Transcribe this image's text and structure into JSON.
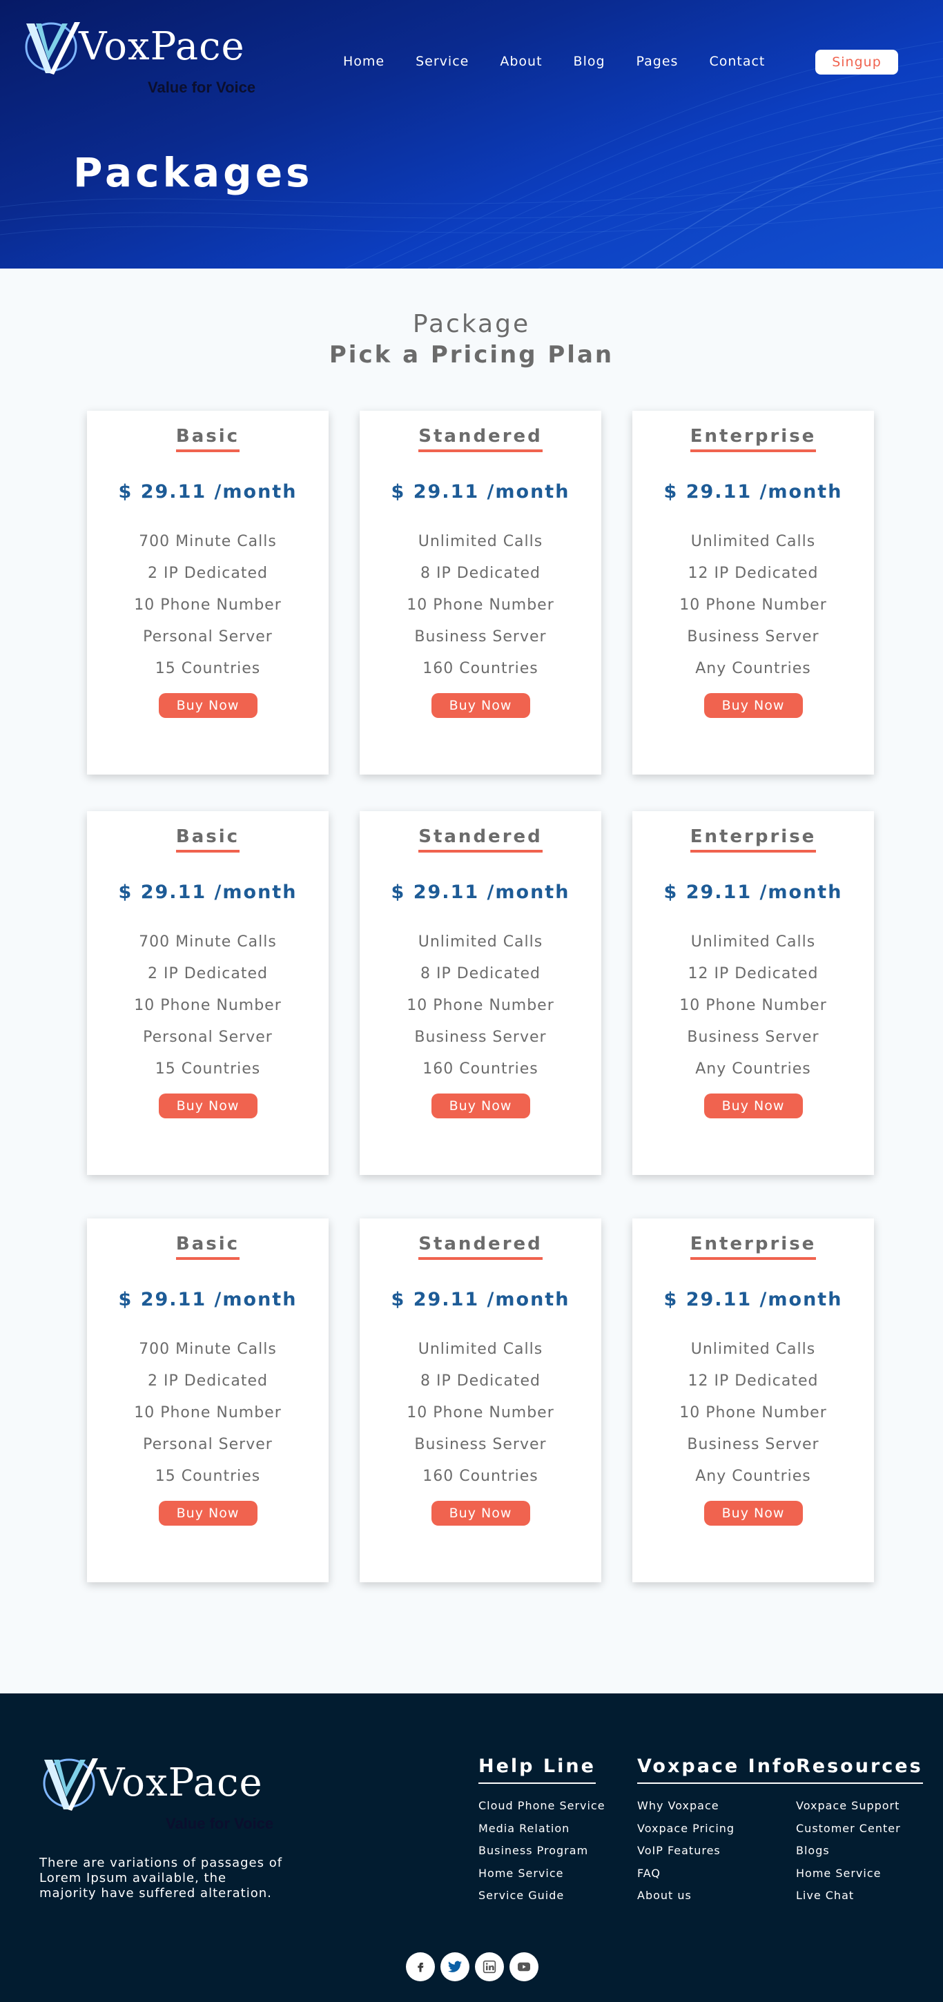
{
  "brand": {
    "name": "VoxPace",
    "tagline": "Value for Voice"
  },
  "nav": {
    "items": [
      {
        "label": "Home"
      },
      {
        "label": "Service"
      },
      {
        "label": "About"
      },
      {
        "label": "Blog"
      },
      {
        "label": "Pages"
      },
      {
        "label": "Contact"
      }
    ],
    "signup_label": "Singup"
  },
  "hero": {
    "title": "Packages"
  },
  "pricing": {
    "subtitle": "Package",
    "title": "Pick a Pricing Plan",
    "buy_label": "Buy Now",
    "rows": [
      {
        "plans": [
          {
            "name": "Basic",
            "price": "$ 29.11 /month",
            "features": [
              "700 Minute Calls",
              "2 IP Dedicated",
              "10 Phone Number",
              "Personal Server",
              "15 Countries"
            ]
          },
          {
            "name": "Standered",
            "price": "$ 29.11 /month",
            "features": [
              "Unlimited Calls",
              "8 IP Dedicated",
              "10 Phone Number",
              "Business Server",
              "160 Countries"
            ]
          },
          {
            "name": "Enterprise",
            "price": "$ 29.11 /month",
            "features": [
              "Unlimited Calls",
              "12 IP Dedicated",
              "10 Phone Number",
              "Business Server",
              "Any Countries"
            ]
          }
        ]
      },
      {
        "plans": [
          {
            "name": "Basic",
            "price": "$ 29.11 /month",
            "features": [
              "700 Minute Calls",
              "2 IP Dedicated",
              "10 Phone Number",
              "Personal Server",
              "15 Countries"
            ]
          },
          {
            "name": "Standered",
            "price": "$ 29.11 /month",
            "features": [
              "Unlimited Calls",
              "8 IP Dedicated",
              "10 Phone Number",
              "Business Server",
              "160 Countries"
            ]
          },
          {
            "name": "Enterprise",
            "price": "$ 29.11 /month",
            "features": [
              "Unlimited Calls",
              "12 IP Dedicated",
              "10 Phone Number",
              "Business Server",
              "Any Countries"
            ]
          }
        ]
      },
      {
        "plans": [
          {
            "name": "Basic",
            "price": "$ 29.11 /month",
            "features": [
              "700 Minute Calls",
              "2 IP Dedicated",
              "10 Phone Number",
              "Personal Server",
              "15 Countries"
            ]
          },
          {
            "name": "Standered",
            "price": "$ 29.11 /month",
            "features": [
              "Unlimited Calls",
              "8 IP Dedicated",
              "10 Phone Number",
              "Business Server",
              "160 Countries"
            ]
          },
          {
            "name": "Enterprise",
            "price": "$ 29.11 /month",
            "features": [
              "Unlimited Calls",
              "12 IP Dedicated",
              "10 Phone Number",
              "Business Server",
              "Any Countries"
            ]
          }
        ]
      }
    ]
  },
  "footer": {
    "description": "There are variations of passages of Lorem Ipsum available, the majority have suffered alteration.",
    "columns": [
      {
        "title": "Help Line",
        "links": [
          "Cloud Phone Service",
          "Media Relation",
          "Business Program",
          "Home Service",
          "Service Guide"
        ]
      },
      {
        "title": "Voxpace Info",
        "links": [
          "Why Voxpace",
          "Voxpace Pricing",
          "VoIP Features",
          "FAQ",
          "About us"
        ]
      },
      {
        "title": "Resources",
        "links": [
          "Voxpace Support",
          "Customer Center",
          "Blogs",
          "Home Service",
          "Live Chat"
        ]
      }
    ],
    "socials": [
      {
        "icon": "facebook-icon"
      },
      {
        "icon": "twitter-icon"
      },
      {
        "icon": "linkedin-icon"
      },
      {
        "icon": "youtube-icon"
      }
    ]
  },
  "colors": {
    "hero_dark": "#061a66",
    "hero_light": "#1250d0",
    "accent": "#f0634f",
    "price": "#1d5b96",
    "footer_bg": "#021c30",
    "page_bg": "#f7fafc"
  }
}
